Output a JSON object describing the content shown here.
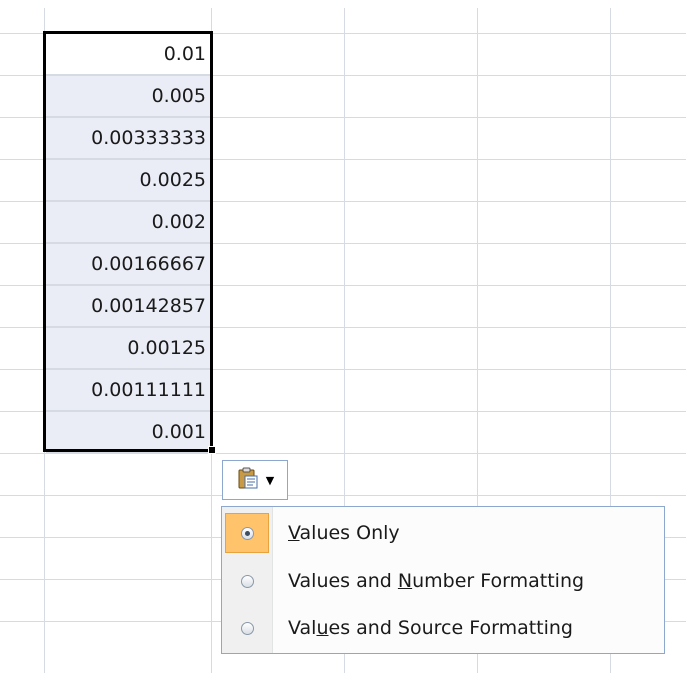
{
  "cells": [
    "0.01",
    "0.005",
    "0.00333333",
    "0.0025",
    "0.002",
    "0.00166667",
    "0.00142857",
    "0.00125",
    "0.00111111",
    "0.001"
  ],
  "paste_options": {
    "button_icon": "clipboard-paste-icon",
    "dropdown_icon": "dropdown-arrow",
    "items": [
      {
        "pre": "",
        "ul": "V",
        "post": "alues Only",
        "checked": true
      },
      {
        "pre": "Values and ",
        "ul": "N",
        "post": "umber Formatting",
        "checked": false
      },
      {
        "pre": "Val",
        "ul": "u",
        "post": "es and Source Formatting",
        "checked": false
      }
    ]
  },
  "colors": {
    "selected_range_fill": "#eaecf6",
    "gridline": "#d6dae3",
    "active_option_highlight": "#ffc46b",
    "menu_border": "#8ea7cf"
  }
}
